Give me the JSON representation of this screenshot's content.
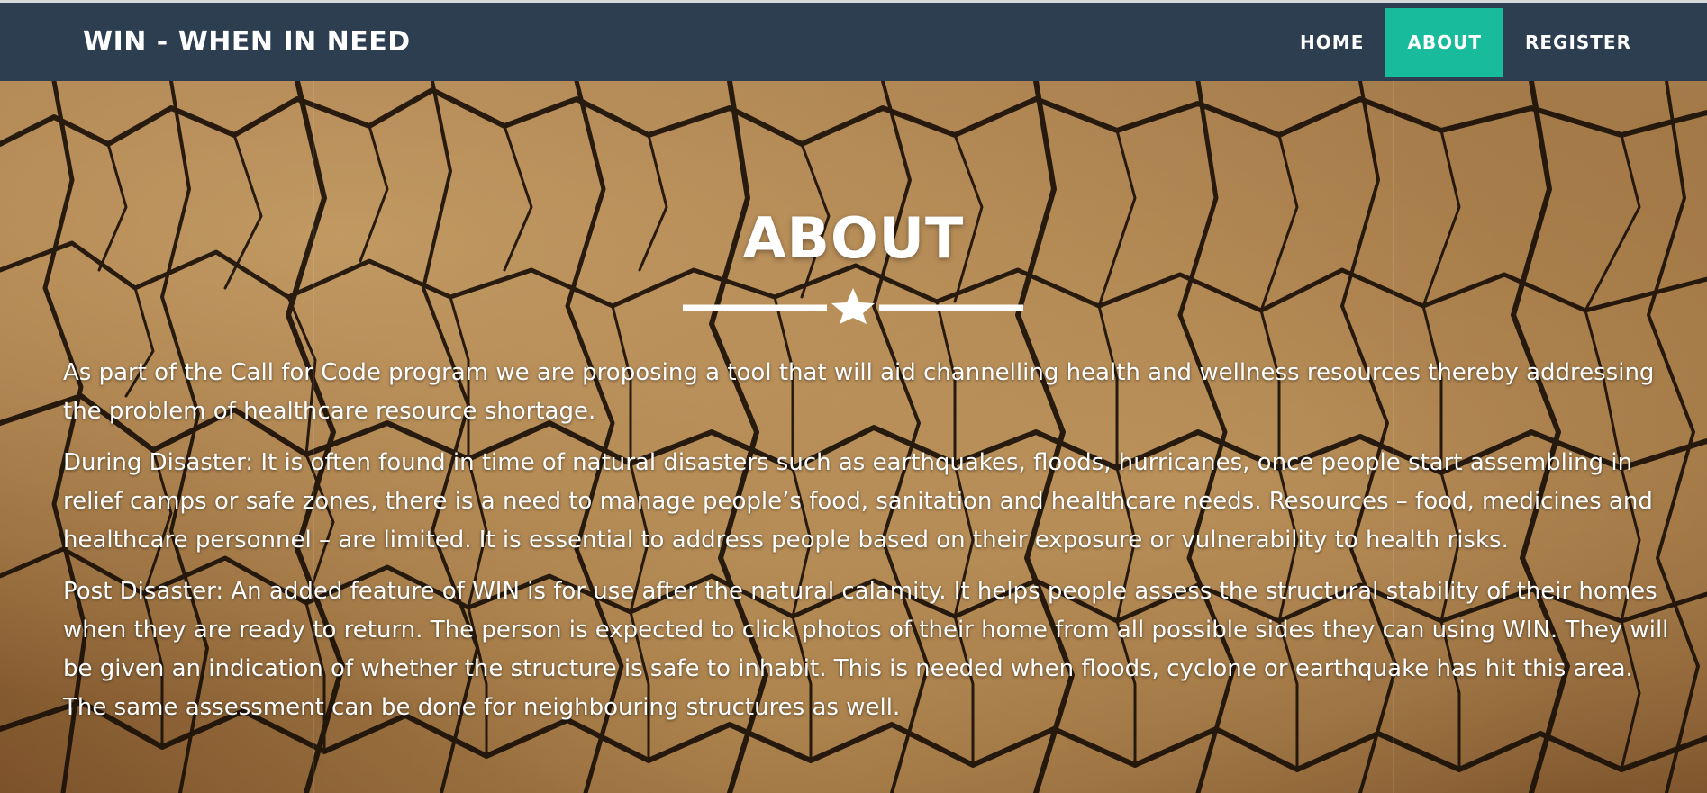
{
  "navbar": {
    "brand": "WIN - WHEN IN NEED",
    "items": [
      {
        "label": "HOME",
        "active": false
      },
      {
        "label": "ABOUT",
        "active": true
      },
      {
        "label": "REGISTER",
        "active": false
      }
    ],
    "colors": {
      "background": "#2c3e50",
      "active": "#18bc9c",
      "text": "#ffffff"
    }
  },
  "section": {
    "title": "ABOUT",
    "divider_icon": "star-icon",
    "paragraphs": [
      "As part of the Call for Code program we are proposing a tool that will aid channelling health and wellness resources thereby addressing the problem of healthcare resource shortage.",
      "During Disaster: It is often found in time of natural disasters such as earthquakes, floods, hurricanes, once people start assembling in relief camps or safe zones, there is a need to manage people’s food, sanitation and healthcare needs. Resources – food, medicines and healthcare personnel – are limited. It is essential to address people based on their exposure or vulnerability to health risks.",
      "Post Disaster: An added feature of WIN is for use after the natural calamity. It helps people assess the structural stability of their homes when they are ready to return. The person is expected to click photos of their home from all possible sides they can using WIN. They will be given an indication of whether the structure is safe to inhabit. This is needed when floods, cyclone or earthquake has hit this area. The same assessment can be done for neighbouring structures as well."
    ],
    "background_image": "cracked-earth"
  }
}
